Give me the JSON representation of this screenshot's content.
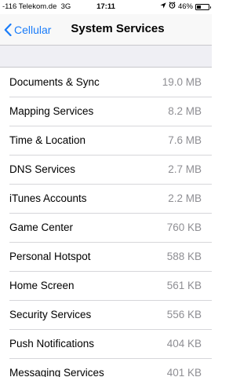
{
  "status_bar": {
    "carrier": "-116 Telekom.de",
    "network": "3G",
    "time": "17:11",
    "battery_percent": "46%",
    "battery_level": 0.46,
    "icons": [
      "location-arrow-icon",
      "alarm-icon",
      "battery-icon"
    ]
  },
  "nav": {
    "back_label": "Cellular",
    "title": "System Services"
  },
  "colors": {
    "accent": "#1a7cf9",
    "secondary_text": "#8e8e93",
    "group_background": "#efeff4"
  },
  "services": [
    {
      "name": "Documents & Sync",
      "usage": "19.0 MB"
    },
    {
      "name": "Mapping Services",
      "usage": "8.2 MB"
    },
    {
      "name": "Time & Location",
      "usage": "7.6 MB"
    },
    {
      "name": "DNS Services",
      "usage": "2.7 MB"
    },
    {
      "name": "iTunes Accounts",
      "usage": "2.2 MB"
    },
    {
      "name": "Game Center",
      "usage": "760 KB"
    },
    {
      "name": "Personal Hotspot",
      "usage": "588 KB"
    },
    {
      "name": "Home Screen",
      "usage": "561 KB"
    },
    {
      "name": "Security Services",
      "usage": "556 KB"
    },
    {
      "name": "Push Notifications",
      "usage": "404 KB"
    },
    {
      "name": "Messaging Services",
      "usage": "401 KB"
    }
  ]
}
